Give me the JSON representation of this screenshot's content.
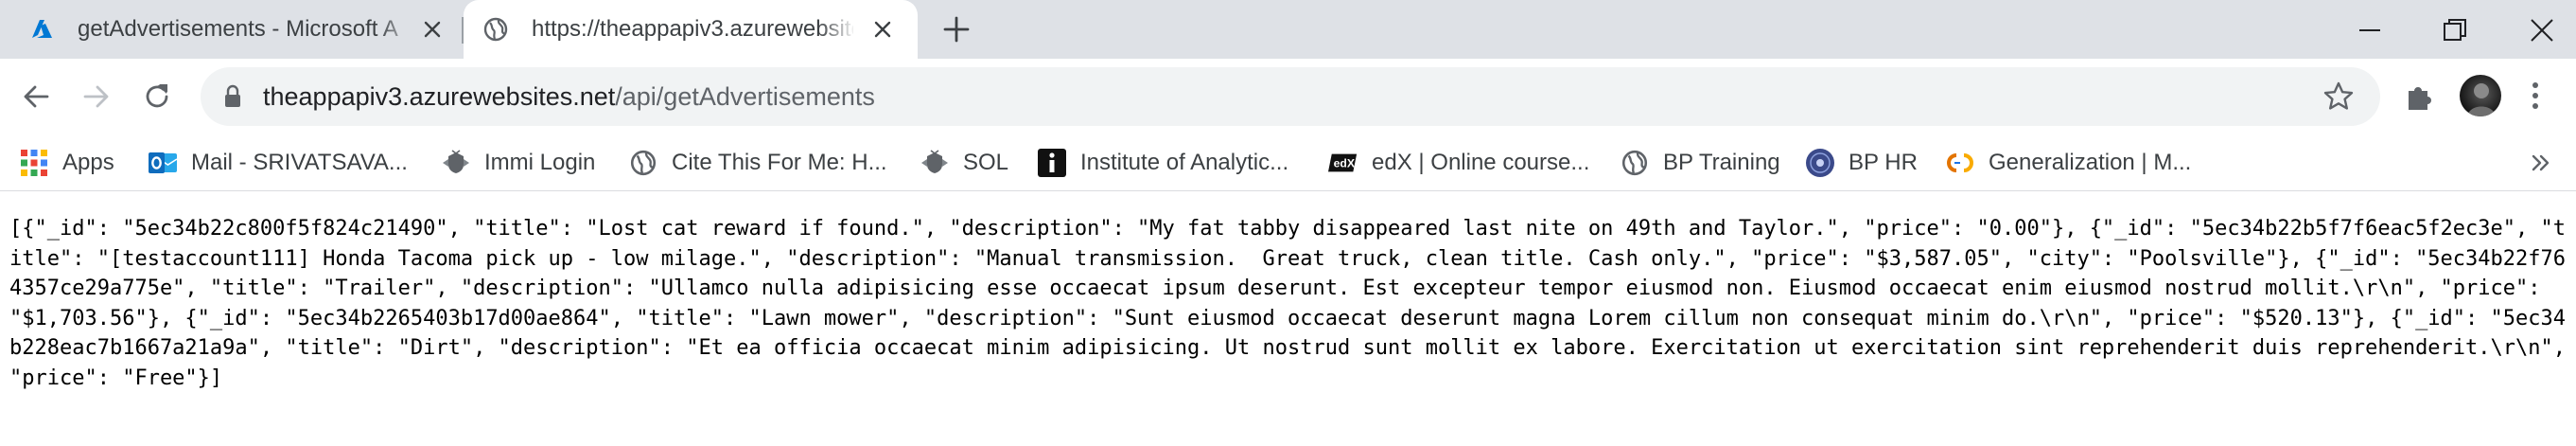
{
  "tabs": [
    {
      "title": "getAdvertisements - Microsoft A",
      "icon": "azure-icon"
    },
    {
      "title": "https://theappapiv3.azurewebsite",
      "icon": "globe-icon"
    }
  ],
  "address_bar": {
    "host": "theappapiv3.azurewebsites.net",
    "path": "/api/getAdvertisements"
  },
  "bookmarks": [
    {
      "label": "Apps",
      "icon": "apps-grid-icon"
    },
    {
      "label": "Mail - SRIVATSAVA...",
      "icon": "outlook-icon"
    },
    {
      "label": "Immi Login",
      "icon": "australia-crest-icon"
    },
    {
      "label": "Cite This For Me: H...",
      "icon": "globe-icon"
    },
    {
      "label": "SOL",
      "icon": "australia-crest-icon"
    },
    {
      "label": "Institute of Analytic...",
      "icon": "info-icon"
    },
    {
      "label": "edX | Online course...",
      "icon": "edx-icon"
    },
    {
      "label": "BP Training",
      "icon": "globe-icon"
    },
    {
      "label": "BP HR",
      "icon": "bp-hr-icon"
    },
    {
      "label": "Generalization  |  M...",
      "icon": "google-colab-icon"
    }
  ],
  "page": {
    "body": "[{\"_id\": \"5ec34b22c800f5f824c21490\", \"title\": \"Lost cat reward if found.\", \"description\": \"My fat tabby disappeared last nite on 49th and Taylor.\", \"price\": \"0.00\"}, {\"_id\": \"5ec34b22b5f7f6eac5f2ec3e\", \"title\": \"[testaccount111] Honda Tacoma pick up - low milage.\", \"description\": \"Manual transmission.  Great truck, clean title. Cash only.\", \"price\": \"$3,587.05\", \"city\": \"Poolsville\"}, {\"_id\": \"5ec34b22f764357ce29a775e\", \"title\": \"Trailer\", \"description\": \"Ullamco nulla adipisicing esse occaecat ipsum deserunt. Est excepteur tempor eiusmod non. Eiusmod occaecat enim eiusmod nostrud mollit.\\r\\n\", \"price\": \"$1,703.56\"}, {\"_id\": \"5ec34b2265403b17d00ae864\", \"title\": \"Lawn mower\", \"description\": \"Sunt eiusmod occaecat deserunt magna Lorem cillum non consequat minim do.\\r\\n\", \"price\": \"$520.13\"}, {\"_id\": \"5ec34b228eac7b1667a21a9a\", \"title\": \"Dirt\", \"description\": \"Et ea officia occaecat minim adipisicing. Ut nostrud sunt mollit ex labore. Exercitation ut exercitation sint reprehenderit duis reprehenderit.\\r\\n\", \"price\": \"Free\"}]"
  },
  "colors": {
    "tabstrip_bg": "#dee1e6",
    "omnibox_bg": "#f1f3f4",
    "azure_blue": "#0078d4",
    "outlook_blue": "#0f6cbd"
  }
}
